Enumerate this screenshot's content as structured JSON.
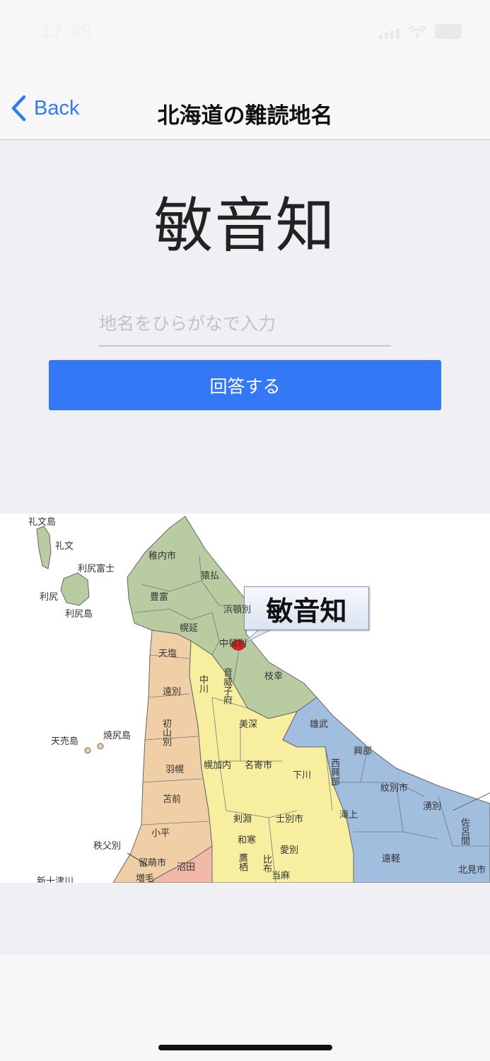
{
  "status": {
    "time": "17:49"
  },
  "nav": {
    "back_label": "Back",
    "title": "北海道の難読地名"
  },
  "quiz": {
    "word": "敏音知",
    "input_placeholder": "地名をひらがなで入力",
    "input_value": "",
    "answer_label": "回答する"
  },
  "map": {
    "callout": "敏音知",
    "labels": {
      "rebun_island": "礼文島",
      "rebun": "礼文",
      "rishirifuji": "利尻富士",
      "rishiri": "利尻",
      "rishiri_island": "利尻島",
      "wakkanai": "稚内市",
      "sarufutsu": "猿払",
      "toyotomi": "豊富",
      "hamatonbetsu": "浜頓別",
      "horonobe": "幌延",
      "nakatonbetsu": "中頓別",
      "teshio": "天塩",
      "esashi": "枝幸",
      "nakagawa": "中川",
      "otoineppu": "音威子府",
      "enbetsu": "遠別",
      "bifuka": "美深",
      "oumu": "雄武",
      "teuri_island": "天売島",
      "yagishiri_island": "焼尻島",
      "shosanbetsu": "初山別",
      "okoppe": "興部",
      "nishiokoppe": "西興部",
      "haboro": "羽幌",
      "horokanai": "幌加内",
      "nayoro": "名寄市",
      "shimokawa": "下川",
      "monbetsu": "紋別市",
      "tomamae": "苫前",
      "takinoue": "滝上",
      "yubetsu": "湧別",
      "saroma": "佐呂間",
      "kenbuchi": "剣淵",
      "shibetsu": "士別市",
      "obira": "小平",
      "wassamu": "和寒",
      "kembetsu": "愛別",
      "chichibubetsu": "秩父別",
      "rumoi": "留萌市",
      "numata": "沼田",
      "engaru": "遠軽",
      "kitami": "北見市",
      "mashike": "増毛",
      "takasu": "鷹栖",
      "pippu": "比布",
      "tohma": "当麻",
      "shintotsukawa": "新十津川"
    }
  },
  "colors": {
    "accent": "#3478f6",
    "region_green": "#b8cba1",
    "region_orange": "#f1cfa6",
    "region_yellow": "#f7ef9f",
    "region_blue": "#a2bedf",
    "region_pink": "#f2b8a8"
  }
}
